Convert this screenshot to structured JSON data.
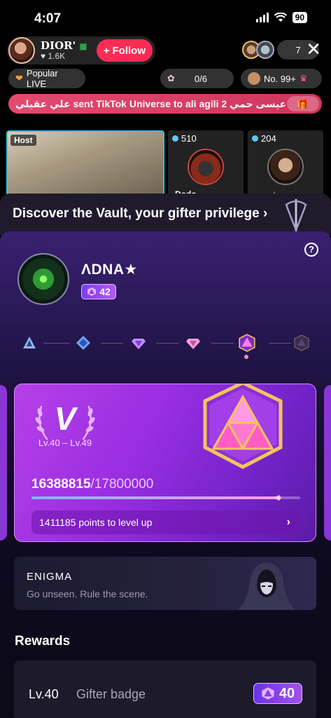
{
  "status_bar": {
    "time": "4:07",
    "battery": "90"
  },
  "live": {
    "host_name": "DIOR'",
    "host_likes": "1.6K",
    "follow_label": "Follow",
    "viewer_count": "7",
    "popular_live": "Popular LIVE",
    "gift_progress": "0/6",
    "rank": "No. 99+",
    "marquee": "علي عقيلي sent TikTok Universe to ali agili 2  عيسى حمي",
    "host_tag": "Host",
    "guest1_score": "510",
    "guest1_name": "Dodo",
    "guest2_score": "204",
    "guest2_name": "ف ري"
  },
  "vault": {
    "title": "Discover the Vault, your gifter privilege",
    "user_name": "ɅDNA★",
    "user_level": "42",
    "current_tier_index": 4,
    "tier_roman": "V",
    "tier_range": "Lv.40 – Lv.49",
    "points_current": "16388815",
    "points_total": "/17800000",
    "progress": 0.9207,
    "points_to_level": "1411185 points to level up",
    "enigma_title": "ENIGMA",
    "enigma_subtitle": "Go unseen. Rule the scene.",
    "rewards_heading": "Rewards",
    "reward_level": "Lv.40",
    "reward_name": "Gifter badge",
    "reward_badge_level": "40"
  },
  "colors": {
    "follow": "#fe2c55",
    "accent_purple": "#9a2ee2",
    "marquee": "#e24a6e",
    "host_border": "#27c7e8"
  }
}
